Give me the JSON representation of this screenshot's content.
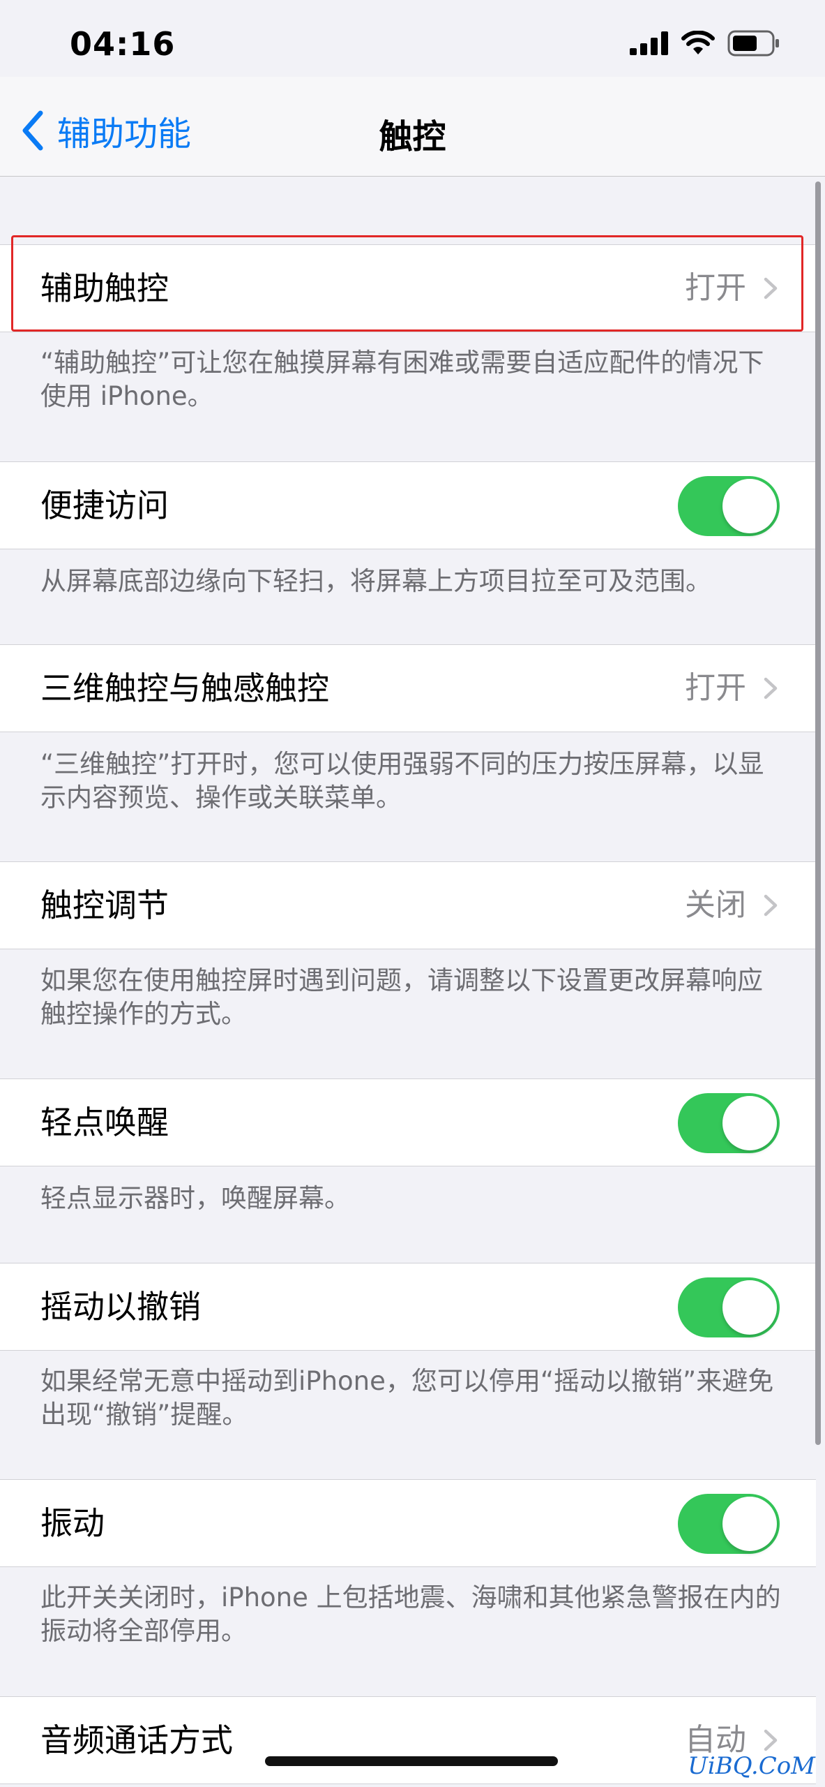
{
  "status_bar": {
    "time": "04:16"
  },
  "nav": {
    "back_label": "辅助功能",
    "title": "触控"
  },
  "rows": [
    {
      "label": "辅助触控",
      "value": "打开",
      "footer": "“辅助触控”可让您在触摸屏幕有困难或需要自适应配件的情况下使用 iPhone。"
    },
    {
      "label": "便捷访问",
      "toggle": true,
      "footer": "从屏幕底部边缘向下轻扫，将屏幕上方项目拉至可及范围。"
    },
    {
      "label": "三维触控与触感触控",
      "value": "打开",
      "footer": "“三维触控”打开时，您可以使用强弱不同的压力按压屏幕，以显示内容预览、操作或关联菜单。"
    },
    {
      "label": "触控调节",
      "value": "关闭",
      "footer": "如果您在使用触控屏时遇到问题，请调整以下设置更改屏幕响应触控操作的方式。"
    },
    {
      "label": "轻点唤醒",
      "toggle": true,
      "footer": "轻点显示器时，唤醒屏幕。"
    },
    {
      "label": "摇动以撤销",
      "toggle": true,
      "footer": "如果经常无意中摇动到iPhone，您可以停用“摇动以撤销”来避免出现“撤销”提醒。"
    },
    {
      "label": "振动",
      "toggle": true,
      "footer": "此开关关闭时，iPhone 上包括地震、海啸和其他紧急警报在内的振动将全部停用。"
    },
    {
      "label": "音频通话方式",
      "value": "自动"
    }
  ],
  "watermark": "UiBQ.CoM",
  "colors": {
    "accent": "#0a7bf5",
    "toggle_on": "#34c759",
    "highlight": "#e12727"
  }
}
